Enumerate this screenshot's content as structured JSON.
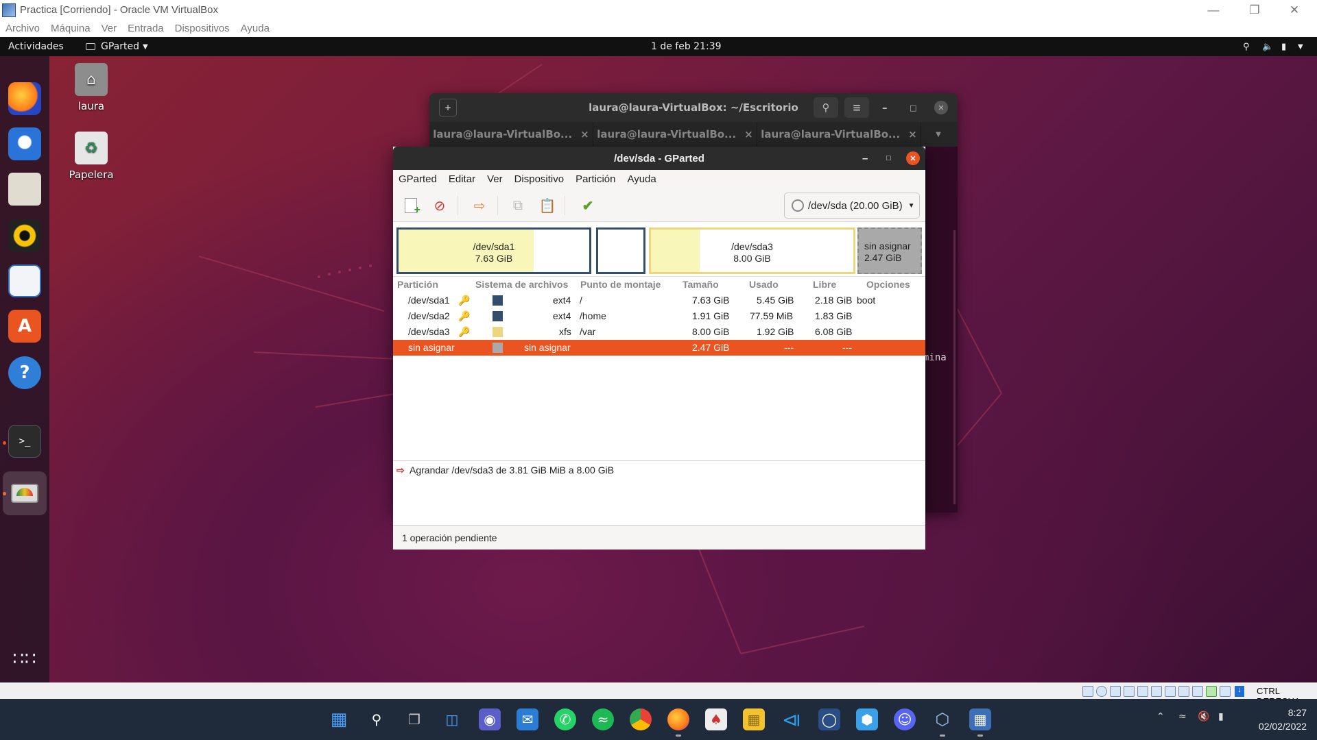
{
  "host": {
    "title": "Practica [Corriendo] - Oracle VM VirtualBox",
    "menu": [
      "Archivo",
      "Máquina",
      "Ver",
      "Entrada",
      "Dispositivos",
      "Ayuda"
    ],
    "statusbar_hostkey": "CTRL DERECHA"
  },
  "ubuntu": {
    "activities": "Actividades",
    "app_menu": "GParted",
    "clock": "1 de feb  21:39",
    "desktop": [
      {
        "label": "laura",
        "icon": "home-folder-icon"
      },
      {
        "label": "Papelera",
        "icon": "trash-icon"
      }
    ],
    "dock": [
      "firefox-icon",
      "thunderbird-icon",
      "files-icon",
      "rhythmbox-icon",
      "libreoffice-writer-icon",
      "software-icon",
      "help-icon",
      "terminal-icon",
      "gparted-icon",
      "app-grid-icon"
    ]
  },
  "terminal": {
    "title": "laura@laura-VirtualBox: ~/Escritorio",
    "tabs": [
      "laura@laura-VirtualBo...",
      "laura@laura-VirtualBo...",
      "laura@laura-VirtualBo..."
    ],
    "visible_text": "mina"
  },
  "gparted": {
    "title": "/dev/sda - GParted",
    "menu": [
      "GParted",
      "Editar",
      "Ver",
      "Dispositivo",
      "Partición",
      "Ayuda"
    ],
    "device": "/dev/sda (20.00 GiB)",
    "diskmap": [
      {
        "name": "/dev/sda1",
        "size": "7.63 GiB",
        "used_fraction": 0.71
      },
      {
        "name": "",
        "size": "",
        "used_fraction": 0.0
      },
      {
        "name": "/dev/sda3",
        "size": "8.00 GiB",
        "used_fraction": 0.24
      },
      {
        "name": "sin asignar",
        "size": "2.47 GiB",
        "used_fraction": 0.0
      }
    ],
    "columns": [
      "Partición",
      "Sistema de archivos",
      "Punto de montaje",
      "Tamaño",
      "Usado",
      "Libre",
      "Opciones"
    ],
    "rows": [
      {
        "partition": "/dev/sda1",
        "fs": "ext4",
        "mount": "/",
        "size": "7.63 GiB",
        "used": "5.45 GiB",
        "free": "2.18 GiB",
        "flags": "boot",
        "color": "#314e6c"
      },
      {
        "partition": "/dev/sda2",
        "fs": "ext4",
        "mount": "/home",
        "size": "1.91 GiB",
        "used": "77.59 MiB",
        "free": "1.83 GiB",
        "flags": "",
        "color": "#314e6c"
      },
      {
        "partition": "/dev/sda3",
        "fs": "xfs",
        "mount": "/var",
        "size": "8.00 GiB",
        "used": "1.92 GiB",
        "free": "6.08 GiB",
        "flags": "",
        "color": "#eed680"
      },
      {
        "partition": "sin asignar",
        "fs": "sin asignar",
        "mount": "",
        "size": "2.47 GiB",
        "used": "---",
        "free": "---",
        "flags": "",
        "color": "#a9a9a9"
      }
    ],
    "operation": "Agrandar /dev/sda3 de 3.81 GiB MiB a 8.00 GiB",
    "status": "1 operación pendiente"
  },
  "windows": {
    "time": "8:27",
    "date": "02/02/2022"
  },
  "colors": {
    "selection": "#e95420",
    "ext4": "#314e6c",
    "xfs": "#eed680",
    "unallocated": "#a9a9a9"
  }
}
